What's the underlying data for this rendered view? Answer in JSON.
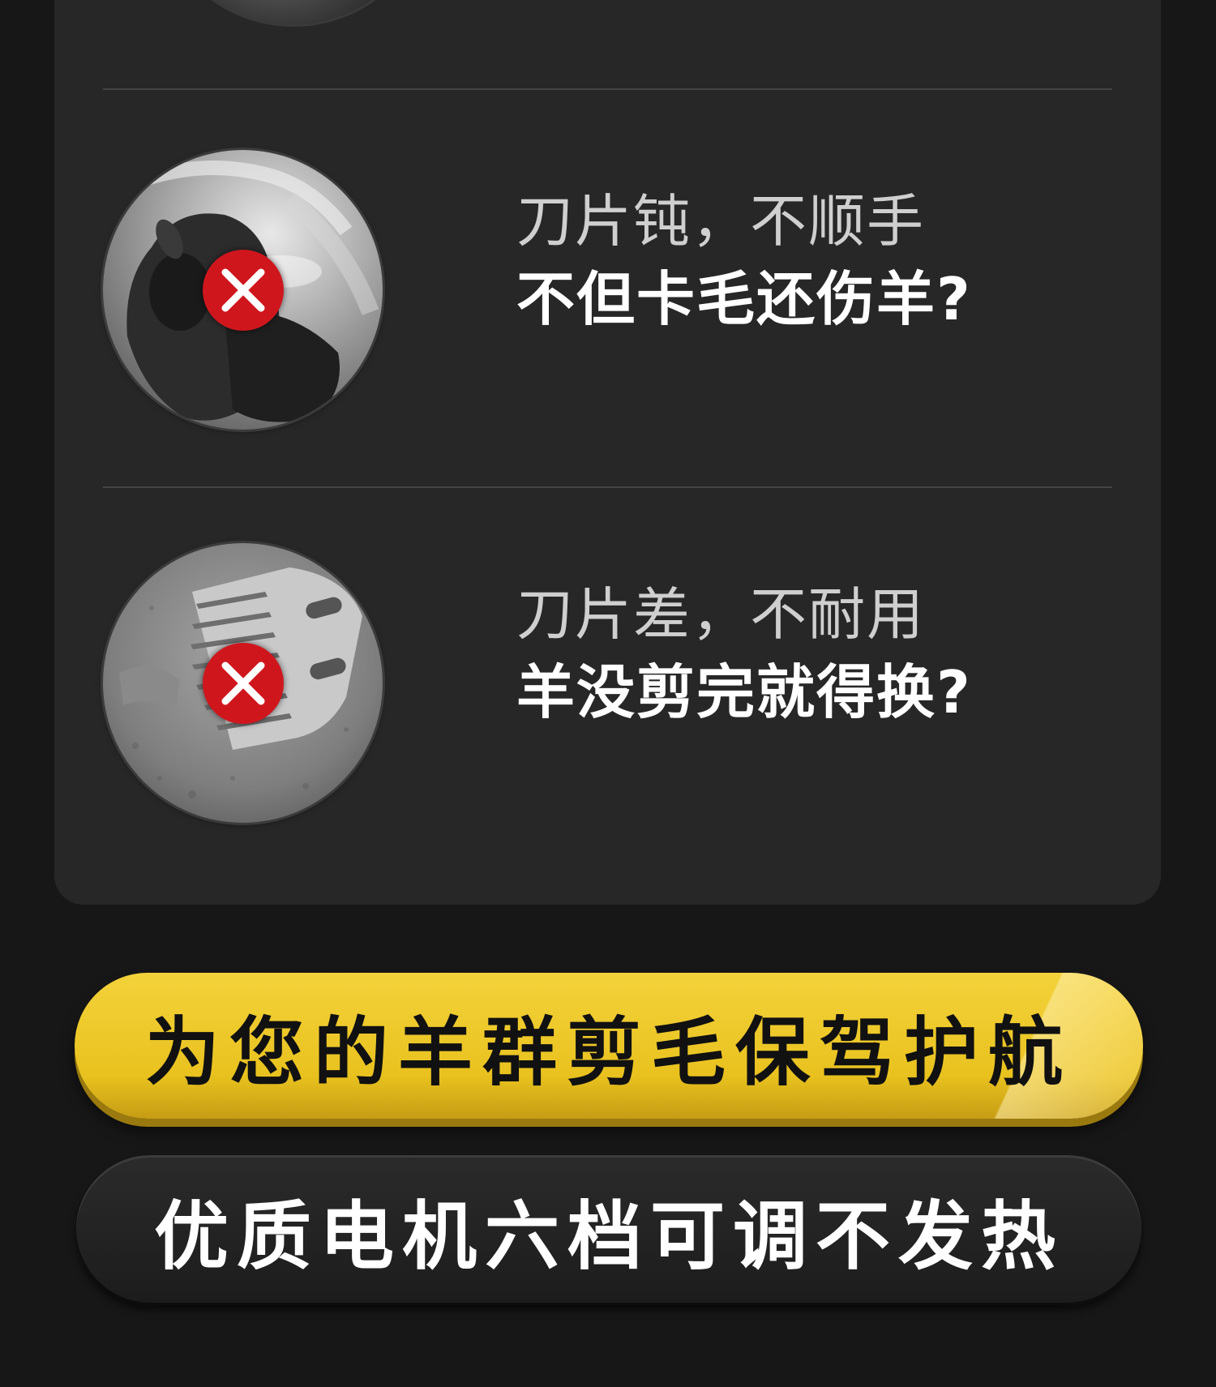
{
  "items": [
    {
      "line1": "刀片钝，不顺手",
      "line2": "不但卡毛还伤羊?",
      "image": "sheep-head-photo",
      "badge_icon": "x-icon"
    },
    {
      "line1": "刀片差，不耐用",
      "line2": "羊没剪完就得换?",
      "image": "clipper-blade-photo",
      "badge_icon": "x-icon"
    }
  ],
  "banners": {
    "primary": "为您的羊群剪毛保驾护航",
    "secondary": "优质电机六档可调不发热"
  },
  "colors": {
    "background": "#171717",
    "card": "#272727",
    "accent_yellow": "#eac620",
    "badge_red": "#d0161d"
  }
}
